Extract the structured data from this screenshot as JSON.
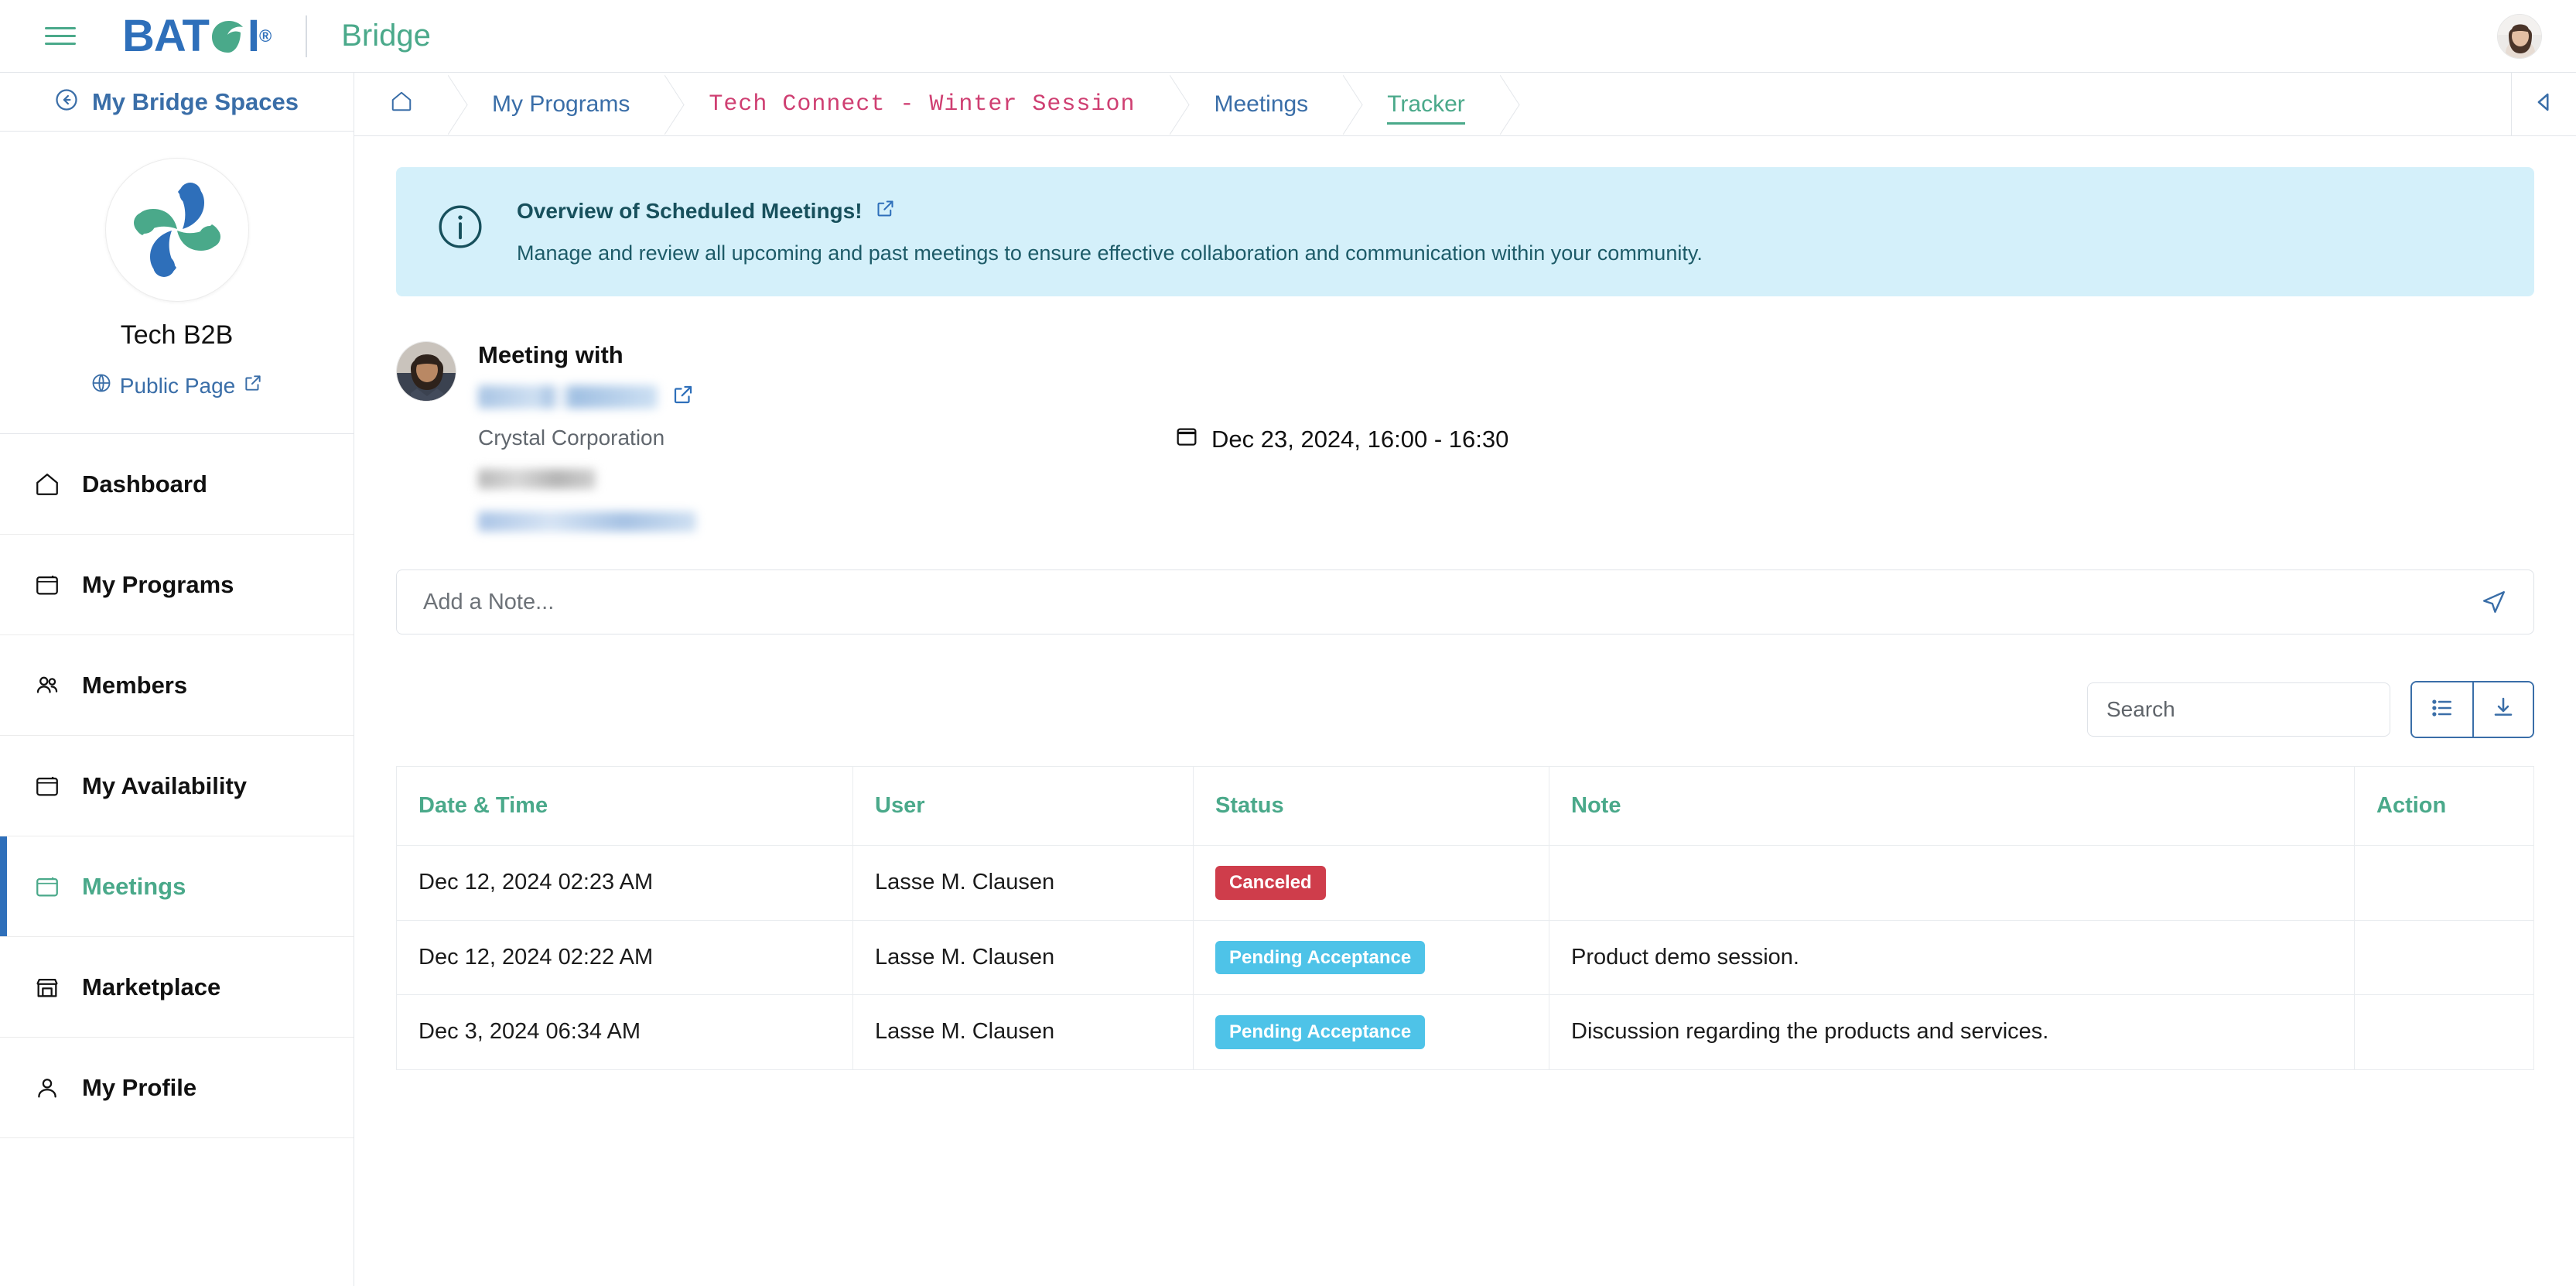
{
  "topbar": {
    "menu_icon": "hamburger-icon",
    "logo_text_left": "BAT",
    "logo_text_right": "I",
    "logo_registered": "®",
    "app_name": "Bridge",
    "avatar": "user-avatar"
  },
  "sidebar": {
    "back_label": "My Bridge Spaces",
    "space_name": "Tech B2B",
    "public_page_label": "Public Page",
    "items": [
      {
        "label": "Dashboard",
        "icon": "home-icon",
        "active": false
      },
      {
        "label": "My Programs",
        "icon": "calendar-icon",
        "active": false
      },
      {
        "label": "Members",
        "icon": "users-icon",
        "active": false
      },
      {
        "label": "My Availability",
        "icon": "calendar-icon",
        "active": false
      },
      {
        "label": "Meetings",
        "icon": "calendar-icon",
        "active": true
      },
      {
        "label": "Marketplace",
        "icon": "store-icon",
        "active": false
      },
      {
        "label": "My Profile",
        "icon": "person-icon",
        "active": false
      }
    ]
  },
  "breadcrumb": {
    "home_icon": "home-icon",
    "items": [
      {
        "label": "My Programs",
        "style": "link"
      },
      {
        "label": "Tech Connect - Winter Session",
        "style": "program"
      },
      {
        "label": "Meetings",
        "style": "link"
      },
      {
        "label": "Tracker",
        "style": "active"
      }
    ],
    "collapse_icon": "chevron-left-icon"
  },
  "banner": {
    "icon": "info-circle-icon",
    "title": "Overview of Scheduled Meetings!",
    "external_icon": "external-link-icon",
    "text": "Manage and review all upcoming and past meetings to ensure effective collaboration and communication within your community."
  },
  "meeting": {
    "heading": "Meeting with",
    "attendee_name_redacted": true,
    "external_icon": "external-link-icon",
    "company": "Crystal Corporation",
    "phone_redacted": true,
    "email_redacted": true,
    "calendar_icon": "calendar-icon",
    "date_time": "Dec 23, 2024, 16:00 - 16:30"
  },
  "note_input": {
    "placeholder": "Add a Note...",
    "value": "",
    "send_icon": "send-icon"
  },
  "toolbar": {
    "search_placeholder": "Search",
    "search_value": "",
    "list_view_icon": "list-icon",
    "download_icon": "download-icon"
  },
  "table": {
    "columns": [
      "Date & Time",
      "User",
      "Status",
      "Note",
      "Action"
    ],
    "rows": [
      {
        "date_time": "Dec 12, 2024 02:23 AM",
        "user": "Lasse M. Clausen",
        "status": "Canceled",
        "status_kind": "canceled",
        "note": "",
        "action": ""
      },
      {
        "date_time": "Dec 12, 2024 02:22 AM",
        "user": "Lasse M. Clausen",
        "status": "Pending Acceptance",
        "status_kind": "pending",
        "note": "Product demo session.",
        "action": ""
      },
      {
        "date_time": "Dec 3, 2024 06:34 AM",
        "user": "Lasse M. Clausen",
        "status": "Pending Acceptance",
        "status_kind": "pending",
        "note": "Discussion regarding the products and services.",
        "action": ""
      }
    ]
  },
  "colors": {
    "brand_blue": "#2e6fba",
    "brand_green": "#4aa98a",
    "link_blue": "#3a6ea8",
    "program_pink": "#cf3f72",
    "banner_bg": "#d4f0fa",
    "banner_text": "#17505c",
    "badge_canceled": "#cf3d4b",
    "badge_pending": "#4ec3e8"
  }
}
